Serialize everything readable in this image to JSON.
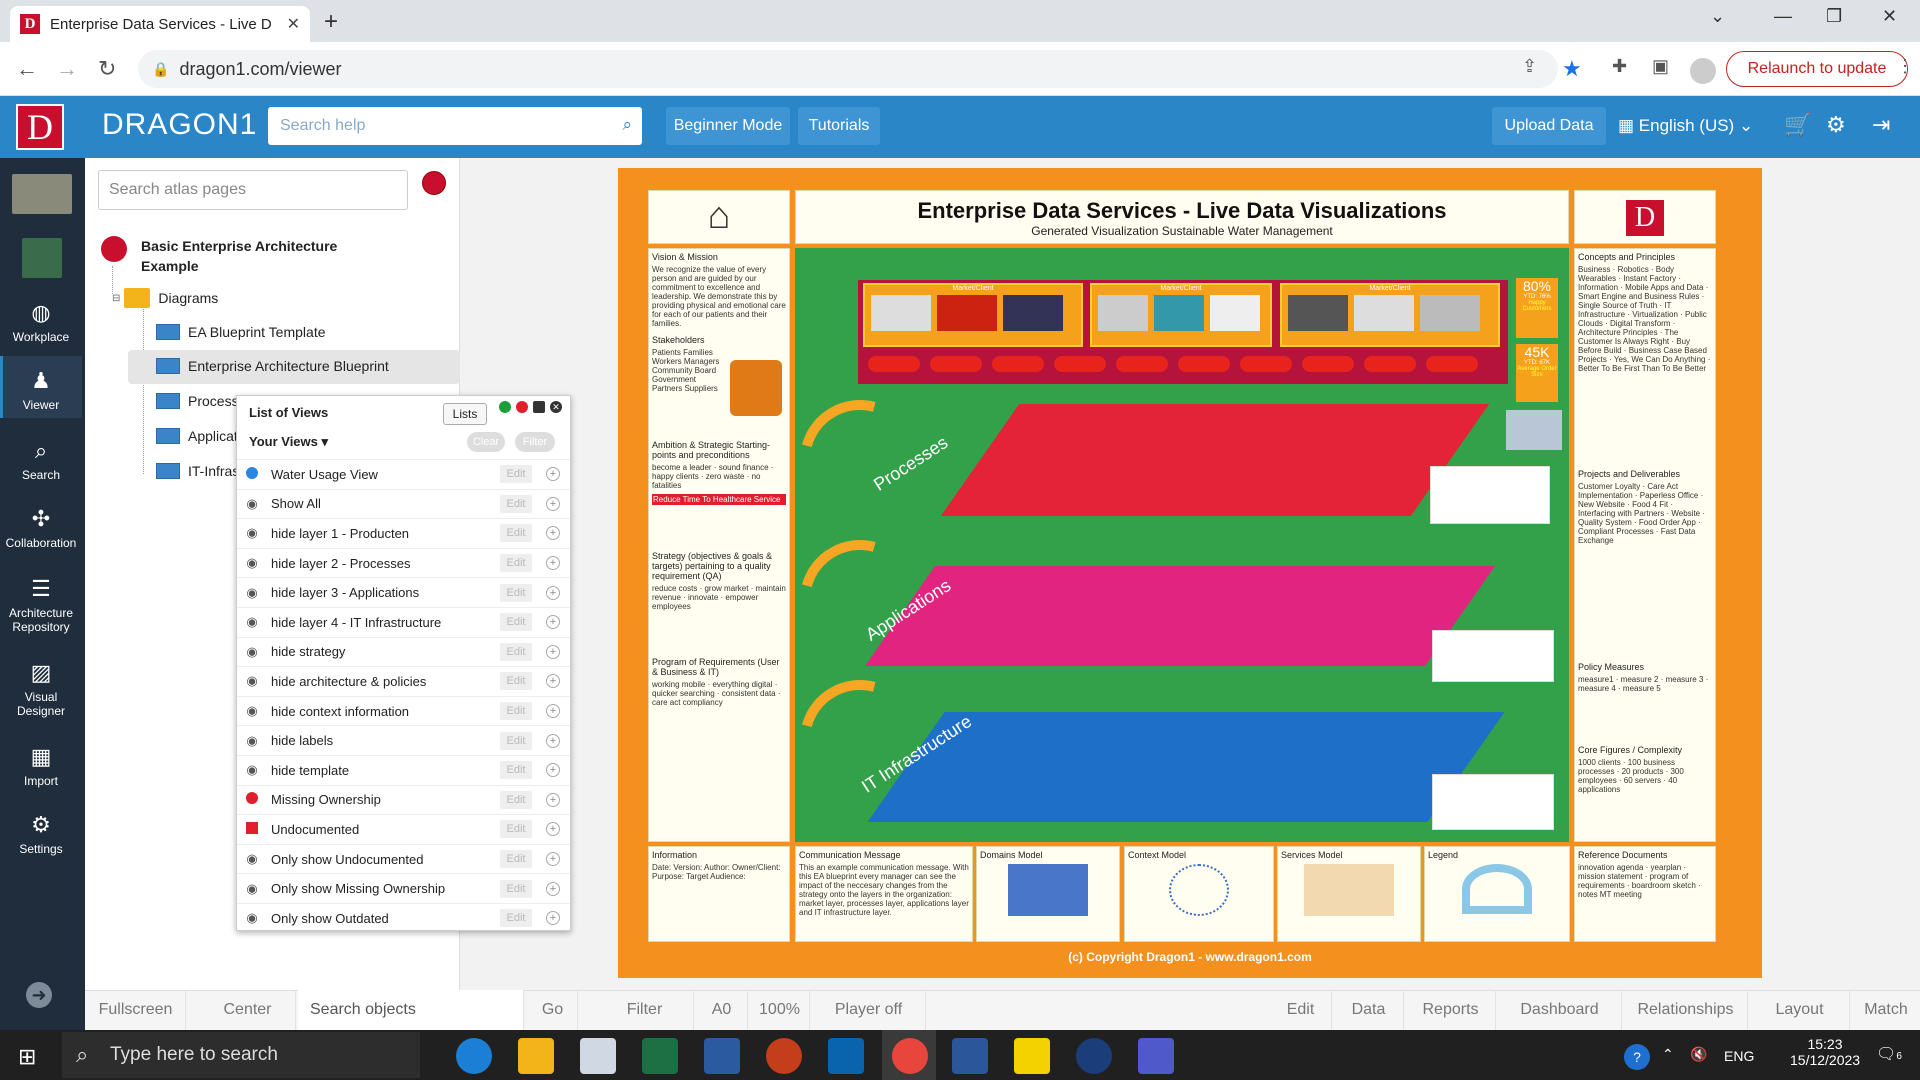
{
  "browser": {
    "tab_title": "Enterprise Data Services - Live D",
    "url": "dragon1.com/viewer",
    "relaunch": "Relaunch to update"
  },
  "header": {
    "brand": "DRAGON1",
    "search_placeholder": "Search help",
    "beginner_mode": "Beginner Mode",
    "tutorials": "Tutorials",
    "upload": "Upload Data",
    "language": "English (US)"
  },
  "iconbar": [
    {
      "label": "Workplace",
      "icon": "workplace-icon"
    },
    {
      "label": "Viewer",
      "icon": "viewer-icon"
    },
    {
      "label": "Search",
      "icon": "search-icon"
    },
    {
      "label": "Collaboration",
      "icon": "collaboration-icon"
    },
    {
      "label": "Architecture Repository",
      "icon": "database-icon"
    },
    {
      "label": "Visual Designer",
      "icon": "image-icon"
    },
    {
      "label": "Import",
      "icon": "grid-icon"
    },
    {
      "label": "Settings",
      "icon": "gear-icon"
    }
  ],
  "tree": {
    "search_placeholder": "Search atlas pages",
    "root": "Basic Enterprise Architecture Example",
    "folder": "Diagrams",
    "items": [
      "EA Blueprint Template",
      "Enterprise Architecture Blueprint",
      "Process",
      "Applicat",
      "IT-Infras"
    ]
  },
  "list_of_views": {
    "title": "List of Views",
    "lists_btn": "Lists",
    "your_views": "Your Views",
    "clear": "Clear",
    "filter": "Filter",
    "edit": "Edit",
    "rows": [
      {
        "label": "Water Usage View",
        "icon": "blue-dot"
      },
      {
        "label": "Show All",
        "icon": "eye-icon"
      },
      {
        "label": "hide layer 1 - Producten",
        "icon": "eye-icon"
      },
      {
        "label": "hide layer 2 - Processes",
        "icon": "eye-icon"
      },
      {
        "label": "hide layer 3 - Applications",
        "icon": "eye-icon"
      },
      {
        "label": "hide layer 4 - IT Infrastructure",
        "icon": "eye-icon"
      },
      {
        "label": "hide strategy",
        "icon": "eye-icon"
      },
      {
        "label": "hide architecture & policies",
        "icon": "eye-icon"
      },
      {
        "label": "hide context information",
        "icon": "eye-icon"
      },
      {
        "label": "hide labels",
        "icon": "eye-icon"
      },
      {
        "label": "hide template",
        "icon": "eye-icon"
      },
      {
        "label": "Missing Ownership",
        "icon": "red-dot"
      },
      {
        "label": "Undocumented",
        "icon": "red-square"
      },
      {
        "label": "Only show Undocumented",
        "icon": "eye-icon"
      },
      {
        "label": "Only show Missing Ownership",
        "icon": "eye-icon"
      },
      {
        "label": "Only show Outdated",
        "icon": "eye-icon"
      }
    ]
  },
  "poster": {
    "title": "Enterprise Data Services - Live Data Visualizations",
    "subtitle": "Generated Visualization Sustainable Water Management",
    "kpi1": "80%",
    "kpi1_sub": "YTD: 76%",
    "kpi1_label": "Happy Customers",
    "kpi2": "45K",
    "kpi2_sub": "YTD: 67K",
    "kpi2_label": "Average Order Size",
    "copyright": "(c) Copyright Dragon1 - www.dragon1.com",
    "layers": [
      "Processes",
      "Applications",
      "IT Infrastructure"
    ],
    "market": "Market/Client",
    "left_sections": [
      {
        "h": "Vision & Mission",
        "t": "We recognize the value of every person and are guided by our commitment to excellence and leadership. We demonstrate this by providing physical and emotional care for each of our patients and their families."
      },
      {
        "h": "Stakeholders",
        "t": "Patients Families Workers Managers Community Board Government Partners Suppliers"
      },
      {
        "h": "Ambition & Strategic Starting-points and preconditions",
        "t": "become a leader · sound finance · happy clients · zero waste · no fatalities"
      },
      {
        "h": "Strategy (objectives & goals & targets) pertaining to a quality requirement (QA)",
        "t": "reduce costs · grow market · maintain revenue · innovate · empower employees"
      },
      {
        "h": "Program of Requirements (User & Business & IT)",
        "t": "working mobile · everything digital · quicker searching · consistent data · care act compliancy"
      }
    ],
    "red_bar": "Reduce Time To Healthcare Service",
    "right_sections": [
      {
        "h": "Concepts and Principles",
        "t": "Business · Robotics · Body Wearables · Instant Factory · Information · Mobile Apps and Data · Smart Engine and Business Rules · Single Source of Truth · IT Infrastructure · Virtualization · Public Clouds · Digital Transform · Architecture Principles · The Customer Is Always Right · Buy Before Build · Business Case Based Projects · Yes, We Can Do Anything · Better To Be First Than To Be Better"
      },
      {
        "h": "Projects and Deliverables",
        "t": "Customer Loyalty · Care Act Implementation · Paperless Office · New Website · Food 4 Fit · Interfacing with Partners · Website · Quality System · Food Order App · Compliant Processes · Fast Data Exchange"
      },
      {
        "h": "Policy Measures",
        "t": "measure1 · measure 2 · measure 3 · measure 4 · measure 5"
      },
      {
        "h": "Core Figures / Complexity",
        "t": "1000 clients · 100 business processes · 20 products · 300 employees · 60 servers · 40 applications"
      }
    ],
    "bottom": [
      {
        "h": "Information",
        "t": "Date: Version: Author: Owner/Client: Purpose: Target Audience:"
      },
      {
        "h": "Communication Message",
        "t": "This an example communication message. With this EA blueprint every manager can see the impact of the neccesary changes from the strategy onto the layers in the organization: market layer, processes layer, applications layer and IT infrastructure layer."
      },
      {
        "h": "Domains Model",
        "t": ""
      },
      {
        "h": "Context Model",
        "t": ""
      },
      {
        "h": "Services Model",
        "t": ""
      },
      {
        "h": "Legend",
        "t": ""
      },
      {
        "h": "Reference Documents",
        "t": "innovation agenda · yearplan · mission statement · program of requirements · boardroom sketch · notes MT meeting"
      }
    ]
  },
  "statusbar": {
    "fullscreen": "Fullscreen",
    "center": "Center",
    "search": "Search objects",
    "go": "Go",
    "filter": "Filter",
    "paper": "A0",
    "zoom": "100%",
    "player": "Player off",
    "edit": "Edit",
    "data": "Data",
    "reports": "Reports",
    "dashboard": "Dashboard",
    "relationships": "Relationships",
    "layout": "Layout",
    "match": "Match"
  },
  "taskbar": {
    "search": "Type here to search",
    "lang": "ENG",
    "time": "15:23",
    "date": "15/12/2023",
    "notif": "6"
  }
}
